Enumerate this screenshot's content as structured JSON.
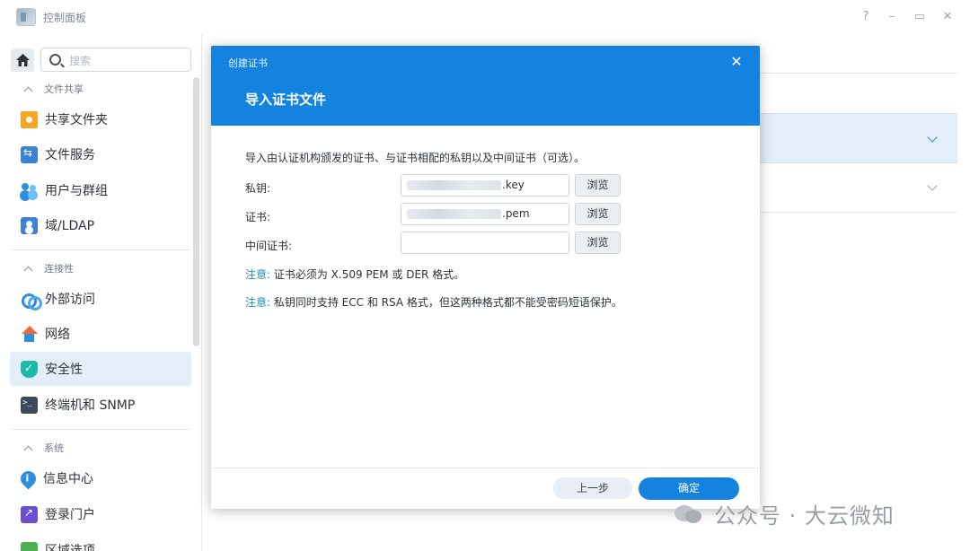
{
  "window": {
    "title": "控制面板",
    "controls": {
      "help": "?",
      "minimize": "–",
      "maximize": "▭",
      "close": "✕"
    }
  },
  "sidebar": {
    "search_placeholder": "搜索",
    "groups": [
      {
        "label": "文件共享"
      },
      {
        "label": "连接性"
      },
      {
        "label": "系统"
      }
    ],
    "items": [
      {
        "label": "共享文件夹",
        "icon": "shared-folder-icon"
      },
      {
        "label": "文件服务",
        "icon": "file-services-icon"
      },
      {
        "label": "用户与群组",
        "icon": "users-icon"
      },
      {
        "label": "域/LDAP",
        "icon": "domain-icon"
      },
      {
        "label": "外部访问",
        "icon": "external-access-icon"
      },
      {
        "label": "网络",
        "icon": "network-icon"
      },
      {
        "label": "安全性",
        "icon": "security-shield-icon",
        "active": true
      },
      {
        "label": "终端机和 SNMP",
        "icon": "terminal-icon"
      },
      {
        "label": "信息中心",
        "icon": "info-center-icon"
      },
      {
        "label": "登录门户",
        "icon": "login-portal-icon"
      },
      {
        "label": "区域选项",
        "icon": "region-icon"
      }
    ]
  },
  "dialog": {
    "window_title": "创建证书",
    "close_glyph": "✕",
    "title": "导入证书文件",
    "intro": "导入由认证机构颁发的证书、与证书相配的私钥以及中间证书（可选）。",
    "fields": [
      {
        "label": "私钥:",
        "value_suffix": ".key",
        "browse": "浏览"
      },
      {
        "label": "证书:",
        "value_suffix": ".pem",
        "browse": "浏览"
      },
      {
        "label": "中间证书:",
        "value_suffix": "",
        "browse": "浏览"
      }
    ],
    "notes": [
      {
        "label": "注意:",
        "text": " 证书必须为 X.509 PEM 或 DER 格式。"
      },
      {
        "label": "注意:",
        "text": " 私钥同时支持 ECC 和 RSA 格式，但这两种格式都不能受密码短语保护。"
      }
    ],
    "buttons": {
      "prev": "上一步",
      "ok": "确定"
    }
  },
  "watermark": {
    "text": "公众号 · 大云微知"
  },
  "colors": {
    "accent": "#1483e0",
    "sidebar_active": "#e4eef8",
    "note_label": "#1a8fb8"
  }
}
